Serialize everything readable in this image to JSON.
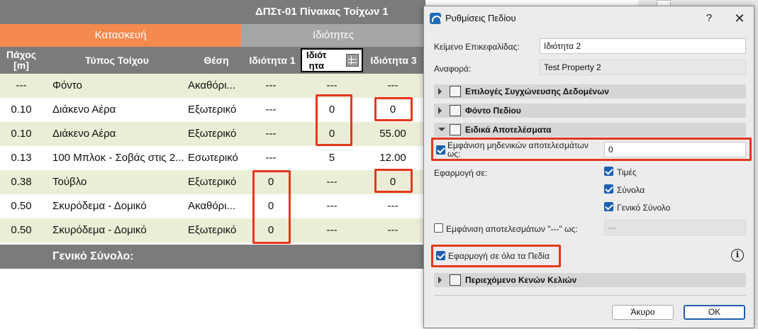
{
  "schedule": {
    "title": "ΔΠΣτ-01 Πίνακας Τοίχων 1",
    "groups": [
      "Κατασκευή",
      "Ιδιότητες"
    ],
    "headers": {
      "thickness": "Πάχος\n[m]",
      "wall_type": "Τύπος Τοίχου",
      "position": "Θέση",
      "prop1": "Ιδιότητα 1",
      "prop2": "Ιδιότ\nητα",
      "prop3": "Ιδιότητα 3"
    },
    "rows": [
      {
        "th": "---",
        "type": "Φόντο",
        "pos": "Ακαθόρι...",
        "p1": "---",
        "p2": "---",
        "p3": "---"
      },
      {
        "th": "0.10",
        "type": "Διάκενο Αέρα",
        "pos": "Εξωτερικό",
        "p1": "---",
        "p2": "0",
        "p3": "0"
      },
      {
        "th": "0.10",
        "type": "Διάκενο Αέρα",
        "pos": "Εξωτερικό",
        "p1": "---",
        "p2": "0",
        "p3": "55.00"
      },
      {
        "th": "0.13",
        "type": "100 Μπλοκ - Σοβάς στις 2...",
        "pos": "Εσωτερικό",
        "p1": "---",
        "p2": "5",
        "p3": "12.00"
      },
      {
        "th": "0.38",
        "type": "Τούβλο",
        "pos": "Εξωτερικό",
        "p1": "0",
        "p2": "---",
        "p3": "0"
      },
      {
        "th": "0.50",
        "type": "Σκυρόδεμα - Δομικό",
        "pos": "Ακαθόρι...",
        "p1": "0",
        "p2": "---",
        "p3": "---"
      },
      {
        "th": "0.50",
        "type": "Σκυρόδεμα - Δομικό",
        "pos": "Εξωτερικό",
        "p1": "0",
        "p2": "---",
        "p3": "---"
      }
    ],
    "total_label": "Γενικό Σύνολο:"
  },
  "dialog": {
    "title": "Ρυθμίσεις Πεδίου",
    "help": "?",
    "close": "✕",
    "header_text_label": "Κείμενο Επικεφαλίδας:",
    "header_text_value": "Ιδιότητα 2",
    "reference_label": "Αναφορά:",
    "reference_value": "Test Property 2",
    "sections": {
      "merge": "Επιλογές Συγχώνευσης Δεδομένων",
      "background": "Φόντο Πεδίου",
      "special": "Ειδικά Αποτελέσματα",
      "empty": "Περιεχόμενο Κενών Κελιών"
    },
    "show_zero_label": "Εμφάνιση μηδενικών αποτελεσμάτων ως:",
    "show_zero_value": "0",
    "apply_to_label": "Εφαρμογή σε:",
    "apply_options": [
      "Τιμές",
      "Σύνολα",
      "Γενικό Σύνολο"
    ],
    "show_dash_label": "Εμφάνιση αποτελεσμάτων \"---\" ως:",
    "show_dash_value": "---",
    "apply_all_label": "Εφαρμογή σε όλα τα Πεδία",
    "info": "i",
    "cancel": "Άκυρο",
    "ok": "OK"
  }
}
